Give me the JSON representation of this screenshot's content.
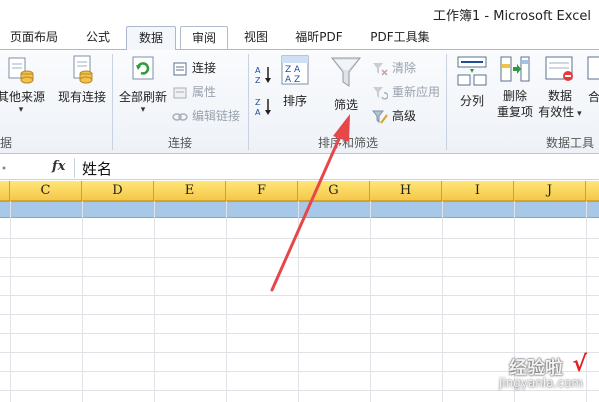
{
  "window": {
    "title": "工作簿1 - Microsoft Excel"
  },
  "tabs": [
    {
      "label": "页面布局"
    },
    {
      "label": "公式"
    },
    {
      "label": "数据"
    },
    {
      "label": "审阅"
    },
    {
      "label": "视图"
    },
    {
      "label": "福昕PDF"
    },
    {
      "label": "PDF工具集"
    }
  ],
  "ribbon": {
    "get_external": {
      "other_sources": "其他来源",
      "existing_conn": "现有连接",
      "group_label": "据"
    },
    "connections": {
      "refresh_all": "全部刷新",
      "connections": "连接",
      "properties": "属性",
      "edit_links": "编辑链接",
      "group_label": "连接"
    },
    "sort_filter": {
      "sort": "排序",
      "filter": "筛选",
      "clear": "清除",
      "reapply": "重新应用",
      "advanced": "高级",
      "group_label": "排序和筛选"
    },
    "data_tools": {
      "text_to_columns": "分列",
      "remove_dup_1": "删除",
      "remove_dup_2": "重复项",
      "validation_1": "数据",
      "validation_2": "有效性",
      "consolidate": "合",
      "group_label": "数据工具"
    }
  },
  "formula_bar": {
    "fx": "fx",
    "value": "姓名"
  },
  "columns": [
    "C",
    "D",
    "E",
    "F",
    "G",
    "H",
    "I",
    "J"
  ],
  "watermark": {
    "line1": "经验啦",
    "line2": "jingyanla.com",
    "check": "√"
  },
  "colors": {
    "accent_arrow": "#e8474a",
    "header_yellow": "#f5c84a",
    "selection": "#a8c8ea"
  },
  "icons": [
    "sort-az-icon",
    "sort-za-icon",
    "filter-funnel-icon",
    "refresh-icon",
    "connections-icon",
    "text-to-columns-icon"
  ]
}
